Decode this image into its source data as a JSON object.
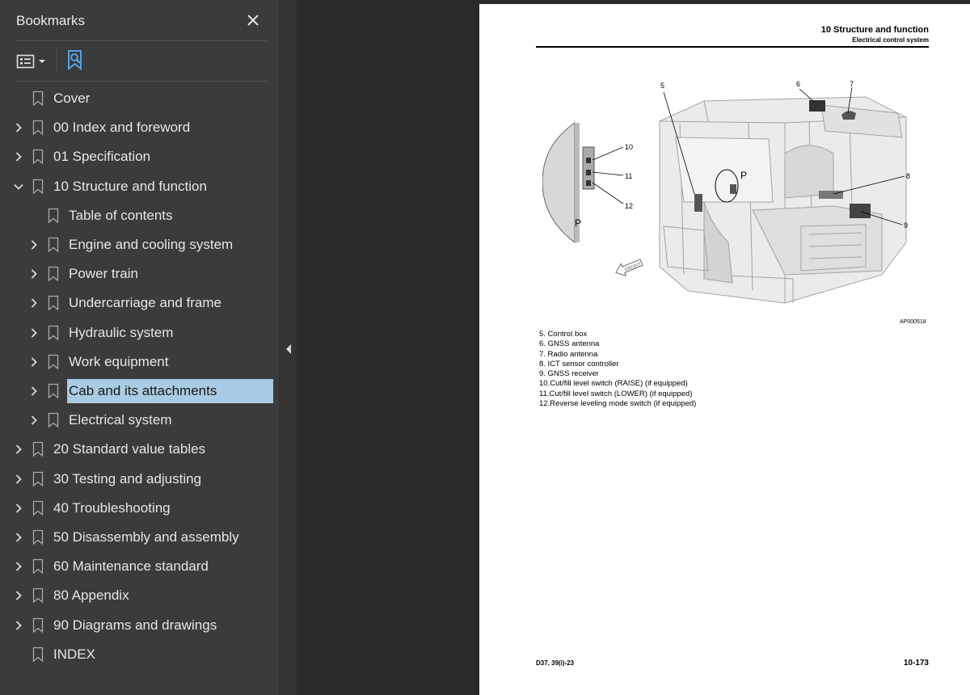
{
  "panel": {
    "title": "Bookmarks",
    "close_icon": "close-icon",
    "options_icon": "list-options-icon",
    "find_icon": "find-bookmark-icon"
  },
  "bookmarks": [
    {
      "label": "Cover",
      "level": 0,
      "expander": "none"
    },
    {
      "label": "00 Index and foreword",
      "level": 0,
      "expander": "collapsed"
    },
    {
      "label": "01 Specification",
      "level": 0,
      "expander": "collapsed"
    },
    {
      "label": "10 Structure and function",
      "level": 0,
      "expander": "expanded"
    },
    {
      "label": "Table of contents",
      "level": 1,
      "expander": "none"
    },
    {
      "label": "Engine and cooling system",
      "level": 1,
      "expander": "collapsed"
    },
    {
      "label": "Power train",
      "level": 1,
      "expander": "collapsed"
    },
    {
      "label": "Undercarriage and frame",
      "level": 1,
      "expander": "collapsed"
    },
    {
      "label": "Hydraulic system",
      "level": 1,
      "expander": "collapsed"
    },
    {
      "label": "Work equipment",
      "level": 1,
      "expander": "collapsed"
    },
    {
      "label": "Cab and its attachments",
      "level": 1,
      "expander": "collapsed",
      "selected": true
    },
    {
      "label": "Electrical system",
      "level": 1,
      "expander": "collapsed"
    },
    {
      "label": "20 Standard value tables",
      "level": 0,
      "expander": "collapsed"
    },
    {
      "label": "30 Testing and adjusting",
      "level": 0,
      "expander": "collapsed"
    },
    {
      "label": "40 Troubleshooting",
      "level": 0,
      "expander": "collapsed"
    },
    {
      "label": "50 Disassembly and assembly",
      "level": 0,
      "expander": "collapsed"
    },
    {
      "label": "60 Maintenance standard",
      "level": 0,
      "expander": "collapsed"
    },
    {
      "label": "80 Appendix",
      "level": 0,
      "expander": "collapsed"
    },
    {
      "label": "90 Diagrams and drawings",
      "level": 0,
      "expander": "collapsed"
    },
    {
      "label": "INDEX",
      "level": 0,
      "expander": "none"
    }
  ],
  "colors": {
    "selected_bg": "#a9cbe3",
    "panel_bg": "#3b3b3b",
    "viewer_bg": "#2a2a2a",
    "find_icon": "#4fa3e8"
  },
  "document": {
    "header_title": "10 Structure and function",
    "header_subtitle": "Electrical control system",
    "callouts": [
      "5",
      "6",
      "7",
      "8",
      "9",
      "10",
      "11",
      "12"
    ],
    "view_label": "P",
    "front_label": "FRONT",
    "figure_code": "AP000518",
    "legend": [
      "5.  Control box",
      "6.  GNSS antenna",
      "7.  Radio antenna",
      "8.  ICT sensor controller",
      "9.  GNSS receiver",
      "10.Cut/fill level switch (RAISE) (if equipped)",
      "11.Cut/fill level switch (LOWER) (if equipped)",
      "12.Reverse leveling mode switch (if equipped)"
    ],
    "footer_model": "D37, 39(i)-23",
    "footer_page": "10-173"
  }
}
